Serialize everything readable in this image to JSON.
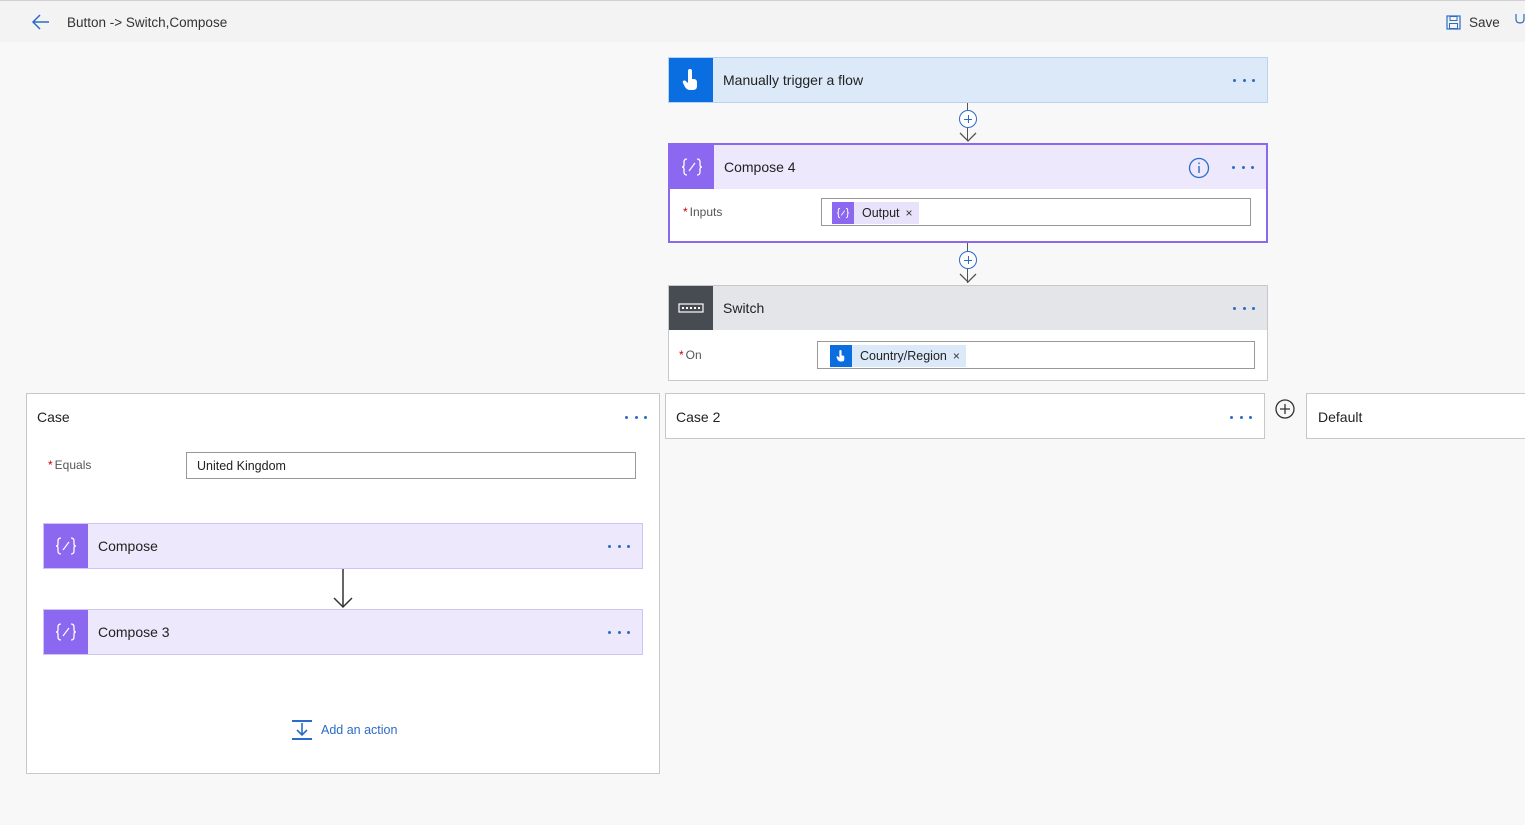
{
  "header": {
    "flow_title": "Button -> Switch,Compose",
    "save_label": "Save"
  },
  "trigger": {
    "title": "Manually trigger a flow"
  },
  "compose4": {
    "title": "Compose 4",
    "inputs_label": "Inputs",
    "token_label": "Output",
    "token_remove": "×"
  },
  "switch": {
    "title": "Switch",
    "on_label": "On",
    "token_label": "Country/Region",
    "token_remove": "×"
  },
  "cases": {
    "case1": {
      "title": "Case",
      "equals_label": "Equals",
      "equals_value": "United Kingdom",
      "actions": [
        "Compose",
        "Compose 3"
      ],
      "add_action_label": "Add an action"
    },
    "case2": {
      "title": "Case 2"
    },
    "default": {
      "title": "Default"
    }
  },
  "required_marker": "*",
  "colors": {
    "accent": "#2b6cc4",
    "trigger_icon_bg": "#0a6ee0",
    "trigger_head_bg": "#dbe9f9",
    "compose_icon_bg": "#8c68f0",
    "compose_head_bg": "#ede8fc",
    "switch_icon_bg": "#474b52",
    "switch_head_bg": "#e3e5e8",
    "required": "#cc0000"
  },
  "icons": {
    "back": "arrow-left-icon",
    "save": "floppy-disk-icon",
    "trigger": "touch-hand-icon",
    "compose": "curly-braces-icon",
    "switch": "switch-keyboard-icon",
    "info": "info-icon",
    "more": "more-dots-icon",
    "add": "plus-circle-icon",
    "add_action": "insert-action-icon"
  }
}
